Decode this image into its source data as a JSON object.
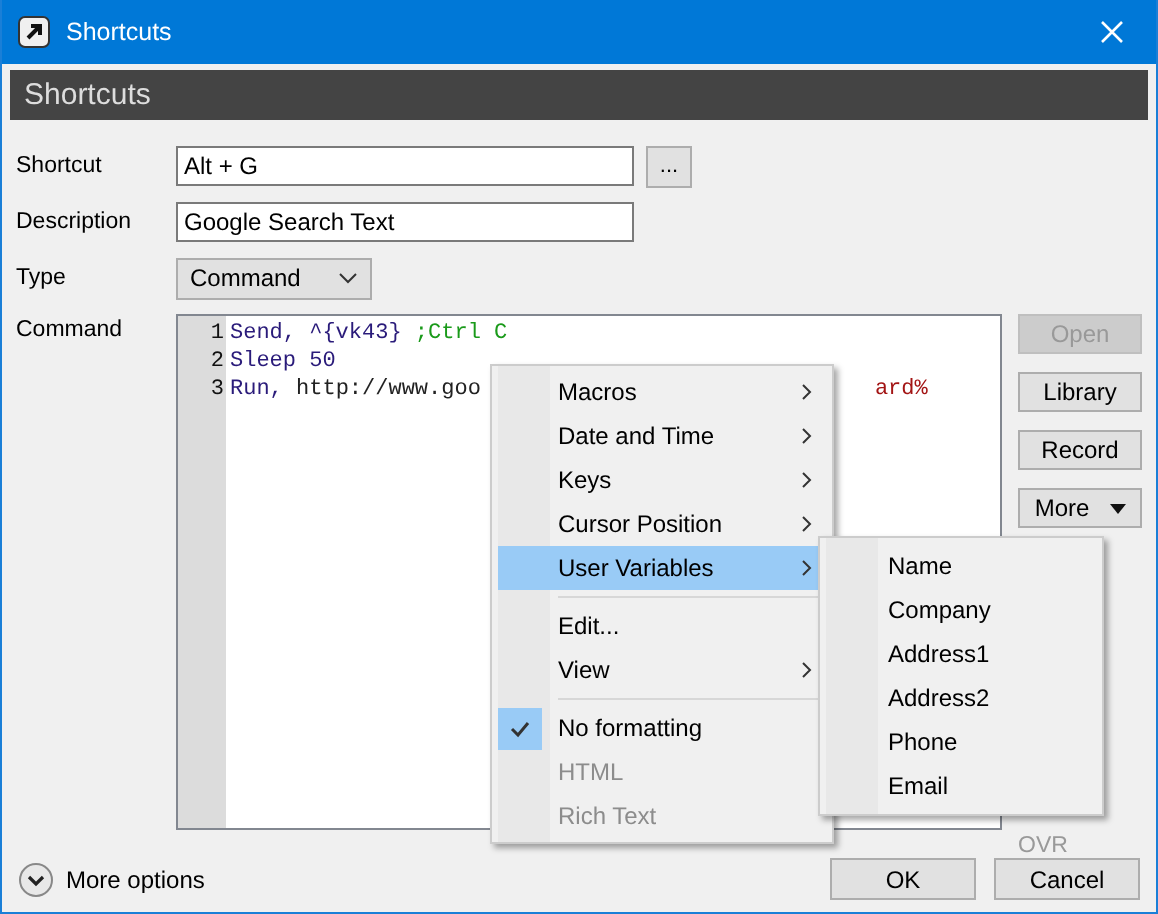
{
  "window": {
    "title": "Shortcuts"
  },
  "header": {
    "title": "Shortcuts"
  },
  "form": {
    "shortcut": {
      "label": "Shortcut",
      "value": "Alt + G",
      "button": "..."
    },
    "description": {
      "label": "Description",
      "value": "Google Search Text"
    },
    "type": {
      "label": "Type",
      "value": "Command"
    },
    "command": {
      "label": "Command",
      "lines": [
        {
          "number": "1",
          "parts": [
            {
              "text": "Send, ^{vk43} ",
              "kind": "keyword"
            },
            {
              "text": ";Ctrl C",
              "kind": "comment"
            }
          ]
        },
        {
          "number": "2",
          "parts": [
            {
              "text": "Sleep 50",
              "kind": "keyword"
            }
          ]
        },
        {
          "number": "3",
          "parts": [
            {
              "text": "Run, ",
              "kind": "keyword"
            },
            {
              "text": "http://www.goo",
              "kind": "plain"
            }
          ],
          "tail": {
            "text": "ard%",
            "kind": "variable"
          }
        }
      ],
      "status": "OVR"
    }
  },
  "side_buttons": [
    {
      "label": "Open",
      "disabled": true,
      "dropdown": false
    },
    {
      "label": "Library",
      "disabled": false,
      "dropdown": false
    },
    {
      "label": "Record",
      "disabled": false,
      "dropdown": false
    },
    {
      "label": "More",
      "disabled": false,
      "dropdown": true
    }
  ],
  "context_menu": {
    "items": [
      {
        "kind": "item",
        "label": "Macros",
        "submenu": true,
        "selected": false,
        "checked": false,
        "disabled": false
      },
      {
        "kind": "item",
        "label": "Date and Time",
        "submenu": true,
        "selected": false,
        "checked": false,
        "disabled": false
      },
      {
        "kind": "item",
        "label": "Keys",
        "submenu": true,
        "selected": false,
        "checked": false,
        "disabled": false
      },
      {
        "kind": "item",
        "label": "Cursor Position",
        "submenu": true,
        "selected": false,
        "checked": false,
        "disabled": false
      },
      {
        "kind": "item",
        "label": "User Variables",
        "submenu": true,
        "selected": true,
        "checked": false,
        "disabled": false
      },
      {
        "kind": "separator"
      },
      {
        "kind": "item",
        "label": "Edit...",
        "submenu": false,
        "selected": false,
        "checked": false,
        "disabled": false
      },
      {
        "kind": "item",
        "label": "View",
        "submenu": true,
        "selected": false,
        "checked": false,
        "disabled": false
      },
      {
        "kind": "separator"
      },
      {
        "kind": "item",
        "label": "No formatting",
        "submenu": false,
        "selected": false,
        "checked": true,
        "disabled": false
      },
      {
        "kind": "item",
        "label": "HTML",
        "submenu": false,
        "selected": false,
        "checked": false,
        "disabled": true
      },
      {
        "kind": "item",
        "label": "Rich Text",
        "submenu": false,
        "selected": false,
        "checked": false,
        "disabled": true
      }
    ]
  },
  "submenu": {
    "items": [
      "Name",
      "Company",
      "Address1",
      "Address2",
      "Phone",
      "Email"
    ]
  },
  "footer": {
    "more_options": "More options",
    "buttons": [
      "OK",
      "Cancel"
    ]
  }
}
